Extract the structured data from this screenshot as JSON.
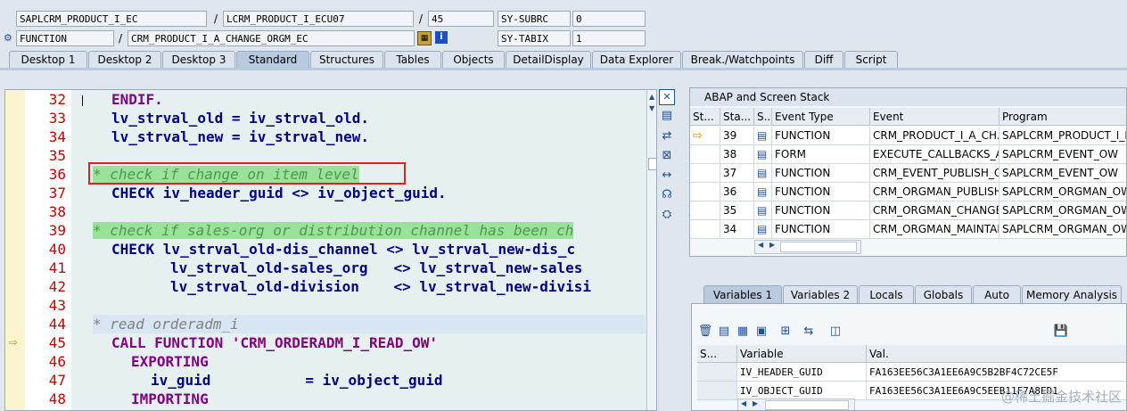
{
  "header": {
    "row1": {
      "program": "SAPLCRM_PRODUCT_I_EC",
      "include": "LCRM_PRODUCT_I_ECU07",
      "line": "45",
      "sysvar_name": "SY-SUBRC",
      "sysvar_value": "0"
    },
    "row2": {
      "type": "FUNCTION",
      "name": "CRM_PRODUCT_I_A_CHANGE_ORGM_EC",
      "sysvar_name": "SY-TABIX",
      "sysvar_value": "1"
    }
  },
  "tabs": [
    "Desktop 1",
    "Desktop 2",
    "Desktop 3",
    "Standard",
    "Structures",
    "Tables",
    "Objects",
    "DetailDisplay",
    "Data Explorer",
    "Break./Watchpoints",
    "Diff",
    "Script"
  ],
  "active_tab": "Standard",
  "editor": {
    "lines": [
      {
        "num": "32",
        "text": "ENDIF."
      },
      {
        "num": "33",
        "text": "lv_strval_old = iv_strval_old."
      },
      {
        "num": "34",
        "text": "lv_strval_new = iv_strval_new."
      },
      {
        "num": "35",
        "text": ""
      },
      {
        "num": "36",
        "text": "* check if change on item level"
      },
      {
        "num": "37",
        "text": "CHECK iv_header_guid <> iv_object_guid."
      },
      {
        "num": "38",
        "text": ""
      },
      {
        "num": "39",
        "text": "* check if sales-org or distribution channel has been ch"
      },
      {
        "num": "40",
        "text": "CHECK lv_strval_old-dis_channel <> lv_strval_new-dis_c"
      },
      {
        "num": "41",
        "text": "lv_strval_old-sales_org   <> lv_strval_new-sales"
      },
      {
        "num": "42",
        "text": "lv_strval_old-division    <> lv_strval_new-divisi"
      },
      {
        "num": "43",
        "text": ""
      },
      {
        "num": "44",
        "text": "* read orderadm_i"
      },
      {
        "num": "45",
        "text": "CALL FUNCTION 'CRM_ORDERADM_I_READ_OW'"
      },
      {
        "num": "46",
        "text": "EXPORTING"
      },
      {
        "num": "47",
        "text": "iv_guid           = iv_object_guid"
      },
      {
        "num": "48",
        "text": "IMPORTING"
      }
    ]
  },
  "stack": {
    "title": "ABAP and Screen Stack",
    "columns": [
      "St...",
      "Sta...",
      "S...",
      "Event Type",
      "Event",
      "Program"
    ],
    "rows": [
      {
        "level": "39",
        "type": "FUNCTION",
        "event": "CRM_PRODUCT_I_A_CH...",
        "program": "SAPLCRM_PRODUCT_I_EC"
      },
      {
        "level": "38",
        "type": "FORM",
        "event": "EXECUTE_CALLBACKS_A...",
        "program": "SAPLCRM_EVENT_OW"
      },
      {
        "level": "37",
        "type": "FUNCTION",
        "event": "CRM_EVENT_PUBLISH_O...",
        "program": "SAPLCRM_EVENT_OW"
      },
      {
        "level": "36",
        "type": "FUNCTION",
        "event": "CRM_ORGMAN_PUBLISH...",
        "program": "SAPLCRM_ORGMAN_OW"
      },
      {
        "level": "35",
        "type": "FUNCTION",
        "event": "CRM_ORGMAN_CHANGE...",
        "program": "SAPLCRM_ORGMAN_OW"
      },
      {
        "level": "34",
        "type": "FUNCTION",
        "event": "CRM_ORGMAN_MAINTAI...",
        "program": "SAPLCRM_ORGMAN_OW"
      }
    ]
  },
  "var_tabs": [
    "Variables 1",
    "Variables 2",
    "Locals",
    "Globals",
    "Auto",
    "Memory Analysis"
  ],
  "active_var_tab": "Variables 1",
  "variables": {
    "columns": [
      "S...",
      "Variable",
      "Val."
    ],
    "rows": [
      {
        "name": "IV_HEADER_GUID",
        "value": "FA163EE56C3A1EE6A9C5B2BF4C72CE5F"
      },
      {
        "name": "IV_OBJECT_GUID",
        "value": "FA163EE56C3A1EE6A9C5EEB11F7A8ED1"
      }
    ]
  },
  "watermark": "@稀土掘金技术社区"
}
